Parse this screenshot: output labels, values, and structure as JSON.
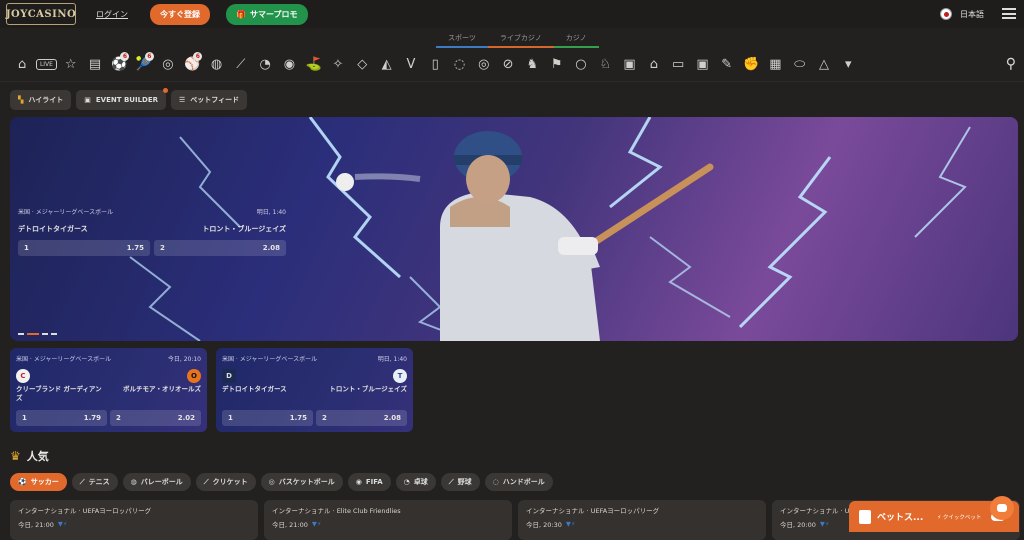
{
  "header": {
    "logo": "JOYCASINO",
    "login": "ログイン",
    "register": "今すぐ登録",
    "promo": "サマープロモ",
    "language": "日本語"
  },
  "mode_tabs": [
    "スポーツ",
    "ライブカジノ",
    "カジノ"
  ],
  "sports_bar": {
    "live_label": "LIVE",
    "badges": [
      "6",
      "6",
      "6"
    ]
  },
  "filters": [
    "ハイライト",
    "EVENT BUILDER",
    "ベットフィード"
  ],
  "hero": {
    "league": "米国 · メジャーリーグベースボール",
    "time": "明日, 1:40",
    "team1": "デトロイトタイガース",
    "team2": "トロント・ブルージェイズ",
    "odds": [
      {
        "label": "1",
        "value": "1.75"
      },
      {
        "label": "2",
        "value": "2.08"
      }
    ]
  },
  "match_cards": [
    {
      "league": "米国 · メジャーリーグベースボール",
      "time": "今日, 20:10",
      "team1": "クリーブランド ガーディアンズ",
      "team2": "ボルチモア・オリオールズ",
      "odds": [
        {
          "label": "1",
          "value": "1.79"
        },
        {
          "label": "2",
          "value": "2.02"
        }
      ]
    },
    {
      "league": "米国 · メジャーリーグベースボール",
      "time": "明日, 1:40",
      "team1": "デトロイトタイガース",
      "team2": "トロント・ブルージェイズ",
      "odds": [
        {
          "label": "1",
          "value": "1.75"
        },
        {
          "label": "2",
          "value": "2.08"
        }
      ]
    }
  ],
  "popular": {
    "title": "人気",
    "tabs": [
      "サッカー",
      "テニス",
      "バレーボール",
      "クリケット",
      "バスケットボール",
      "FIFA",
      "卓球",
      "野球",
      "ハンドボール"
    ]
  },
  "live_cards": [
    {
      "league": "インターナショナル · UEFAヨーロッパリーグ",
      "time": "今日, 21:00"
    },
    {
      "league": "インターナショナル · Elite Club Friendlies",
      "time": "今日, 21:00"
    },
    {
      "league": "インターナショナル · UEFAヨーロッパリーグ",
      "time": "今日, 20:30"
    },
    {
      "league": "インターナショナル · UEFAヨーロッパリーグ",
      "time": "今日, 20:00"
    }
  ],
  "betslip": {
    "label": "ベットス...",
    "quick": "⚡ クイックベット"
  }
}
